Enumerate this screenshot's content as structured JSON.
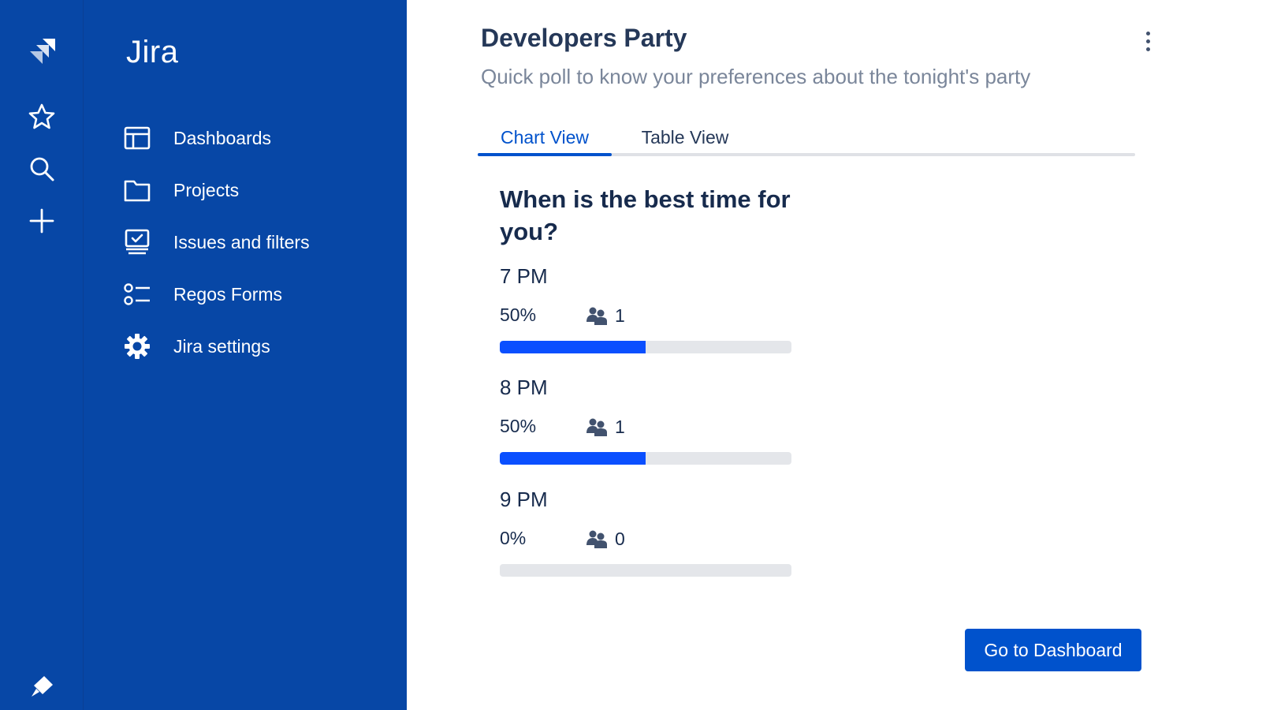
{
  "global_nav": {
    "items": [
      {
        "name": "jira-logo-icon"
      },
      {
        "name": "star-icon"
      },
      {
        "name": "search-icon"
      },
      {
        "name": "plus-icon"
      },
      {
        "name": "notification-icon"
      }
    ]
  },
  "product_nav": {
    "title": "Jira",
    "items": [
      {
        "label": "Dashboards",
        "icon": "dashboard-icon"
      },
      {
        "label": "Projects",
        "icon": "folder-icon"
      },
      {
        "label": "Issues and filters",
        "icon": "issues-icon"
      },
      {
        "label": "Regos Forms",
        "icon": "forms-list-icon"
      },
      {
        "label": "Jira settings",
        "icon": "gear-icon"
      }
    ]
  },
  "main": {
    "title": "Developers Party",
    "subtitle": "Quick poll to know your preferences about the tonight's party",
    "tabs": [
      {
        "label": "Chart View",
        "active": true
      },
      {
        "label": "Table View",
        "active": false
      }
    ],
    "question": "When is the best time for you?",
    "options": [
      {
        "label": "7 PM",
        "percent_text": "50%",
        "votes": "1",
        "fraction": 0.5
      },
      {
        "label": "8 PM",
        "percent_text": "50%",
        "votes": "1",
        "fraction": 0.5
      },
      {
        "label": "9 PM",
        "percent_text": "0%",
        "votes": "0",
        "fraction": 0.0
      }
    ],
    "primary_button": "Go to Dashboard"
  },
  "colors": {
    "nav_background": "#0747a6",
    "accent": "#0052cc",
    "bar_fill": "#0a4fff",
    "bar_track": "#e4e6ea"
  }
}
